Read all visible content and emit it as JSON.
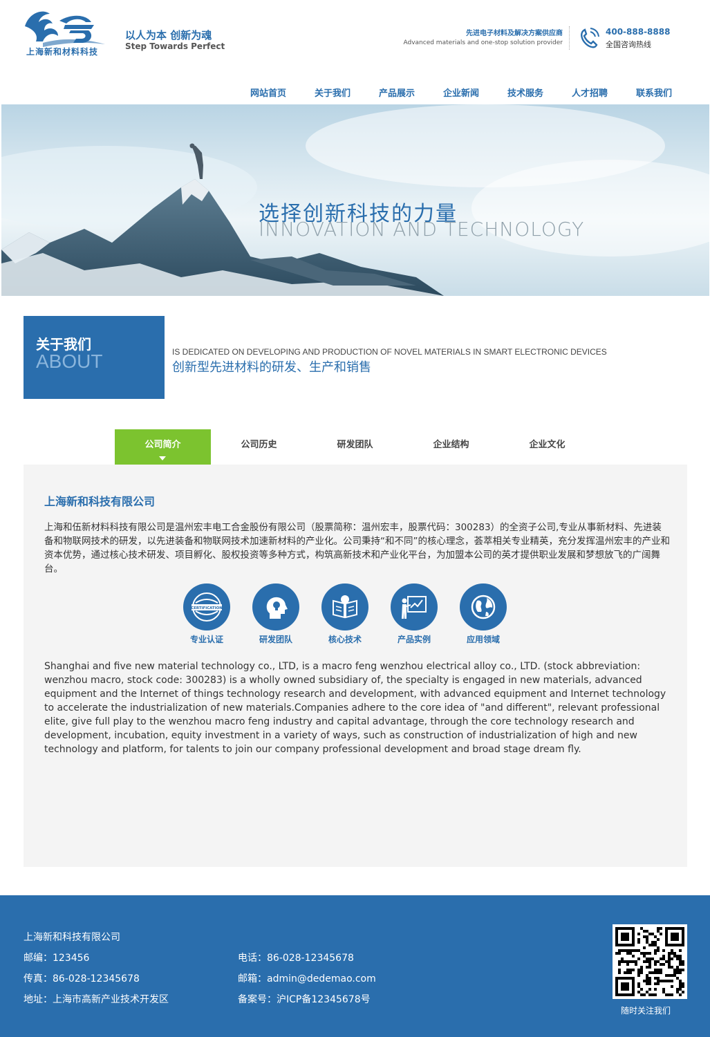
{
  "header": {
    "logo_name": "上海新和材料科技",
    "slogan_cn": "以人为本 创新为魂",
    "slogan_en": "Step Towards Perfect",
    "tagline_cn": "先进电子材料及解决方案供应商",
    "tagline_en": "Advanced materials and one-stop solution provider",
    "hotline_number": "400-888-8888",
    "hotline_label": "全国咨询热线"
  },
  "nav": {
    "items": [
      {
        "label": "网站首页"
      },
      {
        "label": "关于我们"
      },
      {
        "label": "产品展示"
      },
      {
        "label": "企业新闻"
      },
      {
        "label": "技术服务"
      },
      {
        "label": "人才招聘"
      },
      {
        "label": "联系我们"
      }
    ]
  },
  "banner": {
    "title_cn": "选择创新科技的力量",
    "title_en": "INNOVATION AND TECHNOLOGY"
  },
  "about": {
    "heading_cn": "关于我们",
    "heading_en": "ABOUT",
    "sub_en": "IS DEDICATED ON DEVELOPING AND PRODUCTION OF NOVEL MATERIALS IN SMART ELECTRONIC DEVICES",
    "sub_cn": "创新型先进材料的研发、生产和销售"
  },
  "tabs": [
    {
      "label": "公司简介",
      "active": true
    },
    {
      "label": "公司历史",
      "active": false
    },
    {
      "label": "研发团队",
      "active": false
    },
    {
      "label": "企业结构",
      "active": false
    },
    {
      "label": "企业文化",
      "active": false
    }
  ],
  "content": {
    "company_title": "上海新和科技有限公司",
    "intro_cn": "上海和伍新材料科技有限公司是温州宏丰电工合金股份有限公司（股票简称：温州宏丰，股票代码：300283）的全资子公司,专业从事新材料、先进装备和物联网技术的研发，以先进装备和物联网技术加速新材料的产业化。公司秉持“和不同”的核心理念，荟萃相关专业精英，充分发挥温州宏丰的产业和资本优势，通过核心技术研发、项目孵化、股权投资等多种方式，构筑高新技术和产业化平台，为加盟本公司的英才提供职业发展和梦想放飞的广阔舞台。",
    "features": [
      {
        "label": "专业认证",
        "icon": "certification-icon",
        "badge_text": "CERTIFICATION"
      },
      {
        "label": "研发团队",
        "icon": "idea-head-icon"
      },
      {
        "label": "核心技术",
        "icon": "core-tech-icon"
      },
      {
        "label": "产品实例",
        "icon": "presentation-icon"
      },
      {
        "label": "应用领域",
        "icon": "globe-icon"
      }
    ],
    "intro_en": "Shanghai and five new material technology co., LTD, is a macro feng wenzhou electrical alloy co., LTD. (stock abbreviation: wenzhou macro, stock code: 300283) is a wholly owned subsidiary of, the specialty is engaged in new materials, advanced equipment and the Internet of things technology research and development, with advanced equipment and Internet technology to accelerate the industrialization of new materials.Companies adhere to the core idea of \"and different\", relevant professional elite, give full play to the wenzhou macro feng industry and capital advantage, through the core technology research and development, incubation, equity investment in a variety of ways, such as construction of industrialization of high and new technology and platform, for talents to join our company professional development and broad stage dream fly."
  },
  "footer": {
    "company": "上海新和科技有限公司",
    "postcode": "邮编：123456",
    "fax": "传真：86-028-12345678",
    "address": "地址：上海市高新产业技术开发区",
    "phone": "电话：86-028-12345678",
    "email": "邮箱：admin@dedemao.com",
    "icp": "备案号：沪ICP备12345678号",
    "qr_label": "随时关注我们"
  },
  "colors": {
    "brand_blue": "#2a6ead",
    "active_tab_green": "#7cc32f",
    "panel_bg": "#f4f4f4"
  }
}
